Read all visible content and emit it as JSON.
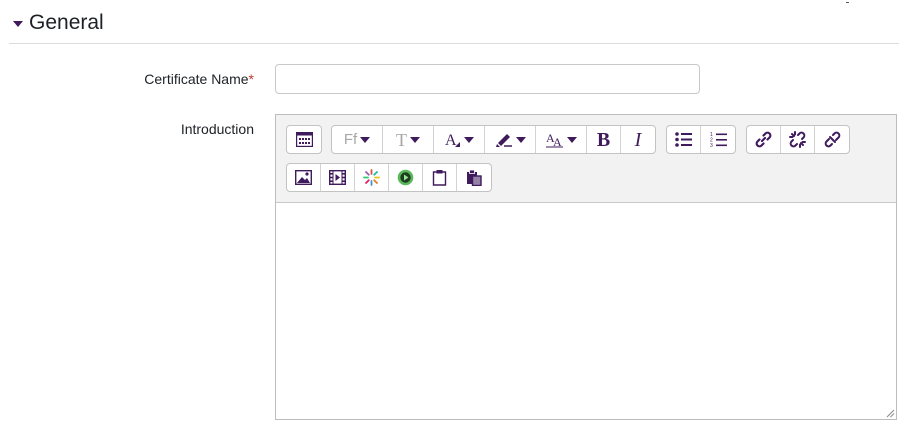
{
  "section": {
    "title": "General",
    "toggle_icon": "caret-down-icon"
  },
  "form": {
    "certificate_name": {
      "label": "Certificate Name",
      "required_mark": "*",
      "value": "",
      "placeholder": ""
    },
    "introduction": {
      "label": "Introduction",
      "value": ""
    }
  },
  "editor": {
    "font_family_label": "Ff",
    "font_size_label": "T",
    "colors": {
      "accent": "#3f1a5c",
      "required": "#c0392b",
      "toolbar_bg": "#f2f2f2"
    },
    "toolbar_icons": [
      "toolbar-toggle-icon",
      "font-family-icon",
      "font-size-icon",
      "font-color-icon",
      "background-color-icon",
      "font-style-icon",
      "bold-icon",
      "italic-icon",
      "unordered-list-icon",
      "ordered-list-icon",
      "link-icon",
      "unlink-icon",
      "anchor-link-icon",
      "image-icon",
      "media-icon",
      "manage-files-icon",
      "record-video-icon",
      "paste-text-icon",
      "paste-icon"
    ],
    "bold_label": "B",
    "italic_label": "I"
  }
}
